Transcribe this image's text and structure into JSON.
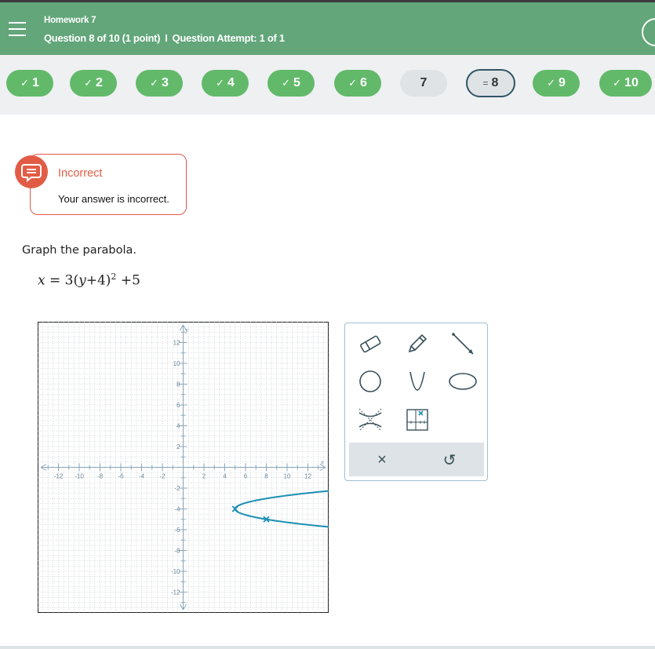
{
  "header": {
    "title": "Homework 7",
    "question": "Question 8 of 10 (1 point)",
    "separator": "I",
    "attempt": "Question Attempt: 1 of 1",
    "bg_color": "#62a67a"
  },
  "nav": {
    "items": [
      {
        "label": "1",
        "status": "correct"
      },
      {
        "label": "2",
        "status": "correct"
      },
      {
        "label": "3",
        "status": "correct"
      },
      {
        "label": "4",
        "status": "correct"
      },
      {
        "label": "5",
        "status": "correct"
      },
      {
        "label": "6",
        "status": "correct"
      },
      {
        "label": "7",
        "status": "unanswered"
      },
      {
        "label": "8",
        "status": "current"
      },
      {
        "label": "9",
        "status": "correct"
      },
      {
        "label": "10",
        "status": "correct"
      }
    ],
    "check_glyph": "✓",
    "current_glyph": "="
  },
  "feedback": {
    "title": "Incorrect",
    "message": "Your answer is incorrect.",
    "color": "#e25c45"
  },
  "question": {
    "prompt": "Graph the parabola.",
    "eq_x": "x",
    "eq_eq": " = 3",
    "eq_open": "(",
    "eq_y": "y",
    "eq_plus": "+4",
    "eq_close": ")",
    "eq_exp": "2",
    "eq_tail": " +5"
  },
  "graph": {
    "x_axis_label": "x",
    "y_axis_label": "y",
    "x_range": [
      -14,
      14
    ],
    "y_range": [
      -14,
      14
    ],
    "x_ticks": [
      "-12",
      "-10",
      "-8",
      "-6",
      "-4",
      "-2",
      "2",
      "4",
      "6",
      "8",
      "10",
      "12"
    ],
    "y_ticks": [
      "12",
      "10",
      "8",
      "6",
      "4",
      "2",
      "-2",
      "-4",
      "-6",
      "-8",
      "-10",
      "-12"
    ],
    "curve": {
      "a": 3,
      "k": -4,
      "h": 5,
      "color": "#1a8fb3"
    },
    "plotted_points": [
      [
        5,
        -4
      ],
      [
        8,
        -5
      ]
    ]
  },
  "tools": {
    "icons": [
      "eraser-icon",
      "pencil-icon",
      "ray-icon",
      "circle-icon",
      "parabola-icon",
      "ellipse-icon",
      "hyperbola-icon",
      "point-tool-icon"
    ],
    "clear_label": "×",
    "reset_label": "↺"
  }
}
